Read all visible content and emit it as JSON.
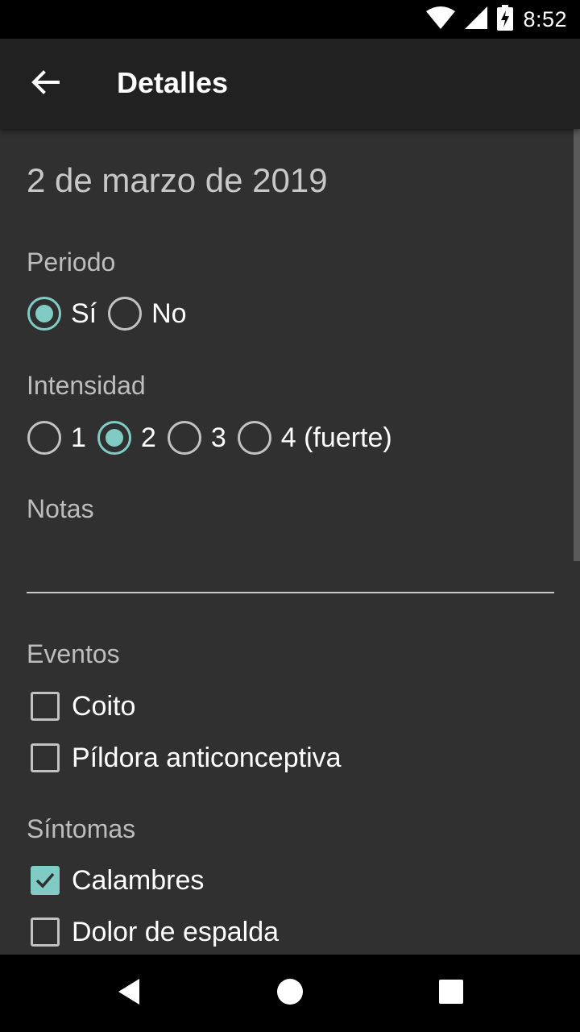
{
  "status_bar": {
    "time": "8:52"
  },
  "app_bar": {
    "title": "Detalles"
  },
  "date": "2 de marzo de 2019",
  "periodo": {
    "label": "Periodo",
    "options": [
      {
        "label": "Sí",
        "checked": true
      },
      {
        "label": "No",
        "checked": false
      }
    ]
  },
  "intensidad": {
    "label": "Intensidad",
    "options": [
      {
        "label": "1",
        "checked": false
      },
      {
        "label": "2",
        "checked": true
      },
      {
        "label": "3",
        "checked": false
      },
      {
        "label": "4 (fuerte)",
        "checked": false
      }
    ]
  },
  "notas": {
    "label": "Notas",
    "value": ""
  },
  "eventos": {
    "label": "Eventos",
    "items": [
      {
        "label": "Coito",
        "checked": false
      },
      {
        "label": "Píldora anticonceptiva",
        "checked": false
      }
    ]
  },
  "sintomas": {
    "label": "Síntomas",
    "items": [
      {
        "label": "Calambres",
        "checked": true
      },
      {
        "label": "Dolor de espalda",
        "checked": false
      }
    ]
  },
  "colors": {
    "accent": "#80cbc4",
    "background": "#303030",
    "app_bar": "#212121"
  }
}
